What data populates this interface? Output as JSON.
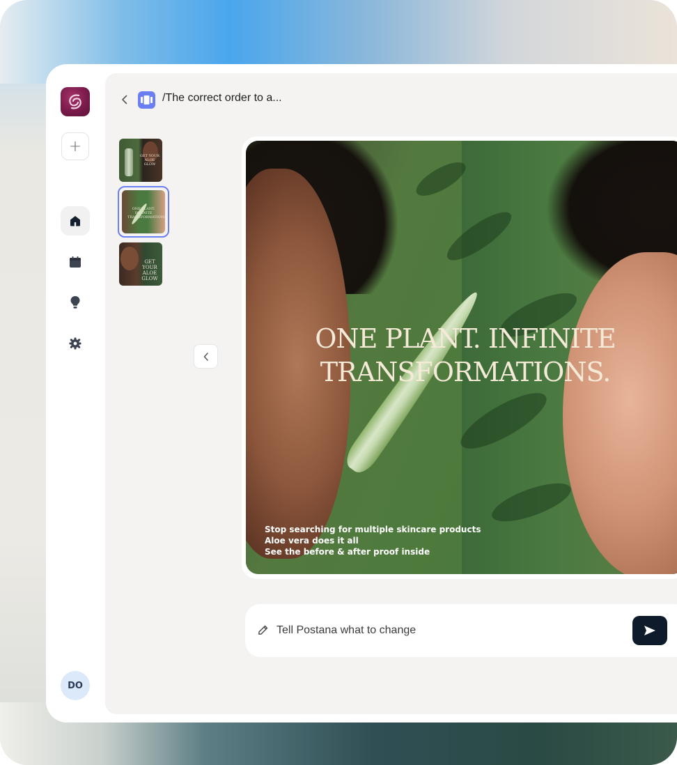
{
  "app": {
    "brand": "Postana",
    "colors": {
      "accent": "#6a7ff3",
      "brand": "#7a1b4b",
      "send": "#0e1b2b"
    }
  },
  "sidebar": {
    "items": [
      {
        "id": "home",
        "icon": "home-icon",
        "active": true
      },
      {
        "id": "calendar",
        "icon": "calendar-icon",
        "active": false
      },
      {
        "id": "ideas",
        "icon": "lightbulb-icon",
        "active": false
      },
      {
        "id": "settings",
        "icon": "gear-icon",
        "active": false
      }
    ],
    "avatar_initials": "DO"
  },
  "header": {
    "title": "/The correct order to a..."
  },
  "thumbnails": [
    {
      "id": "slide-1",
      "selected": false,
      "title": "GET YOUR ALOE GLOW"
    },
    {
      "id": "slide-2",
      "selected": true,
      "title": "ONE PLANT. INFINITE TRANSFORMATIONS."
    },
    {
      "id": "slide-3",
      "selected": false,
      "title": "GET YOUR ALOE GLOW"
    }
  ],
  "preview": {
    "headline_line1": "ONE PLANT. INFINITE",
    "headline_line2": "TRANSFORMATIONS.",
    "copy_line1": "Stop searching for multiple skincare products",
    "copy_line2": "Aloe vera does it all",
    "copy_line3": "See the before & after proof inside"
  },
  "chat": {
    "placeholder": "Tell Postana what to change"
  }
}
